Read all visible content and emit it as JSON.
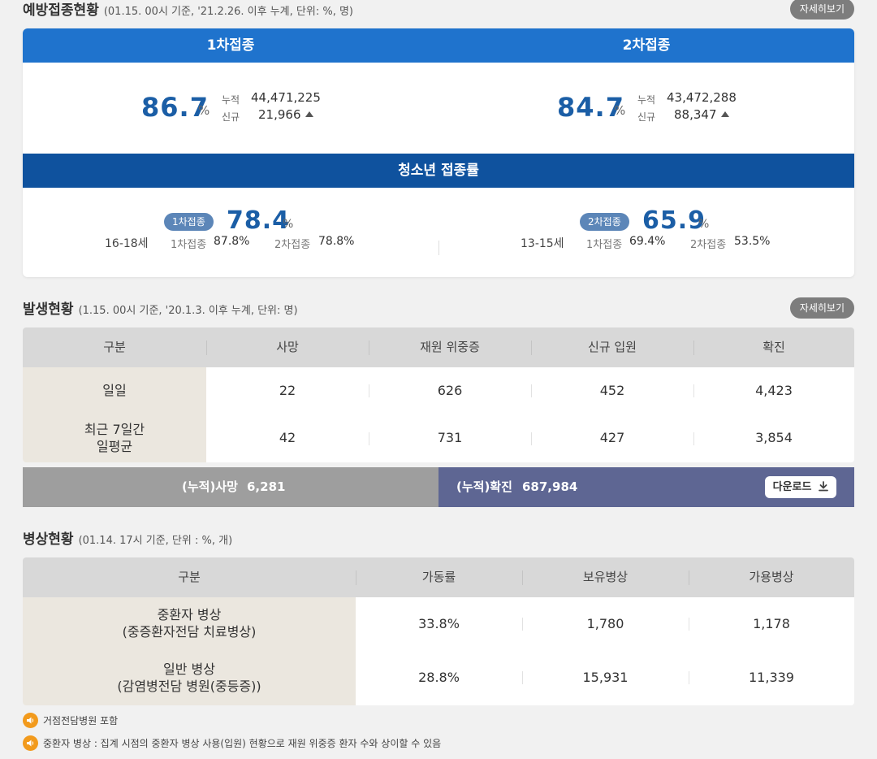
{
  "vaccination": {
    "title": "예방접종현황",
    "subtitle": "(01.15. 00시 기준, '21.2.26. 이후 누계, 단위: %, 명)",
    "detail_label": "자세히보기",
    "first": {
      "head": "1차접종",
      "pct": "86.7",
      "unit": "%",
      "cum_label": "누적",
      "cum_value": "44,471,225",
      "new_label": "신규",
      "new_value": "21,966"
    },
    "second": {
      "head": "2차접종",
      "pct": "84.7",
      "unit": "%",
      "cum_label": "누적",
      "cum_value": "43,472,288",
      "new_label": "신규",
      "new_value": "88,347"
    },
    "youth": {
      "head": "청소년 접종률",
      "left": {
        "age": "16-18세",
        "badge": "1차접종",
        "pct": "78.4",
        "unit": "%",
        "s1_label": "1차접종",
        "s1_value": "87.8%",
        "s2_label": "2차접종",
        "s2_value": "78.8%"
      },
      "right": {
        "age": "13-15세",
        "badge": "2차접종",
        "pct": "65.9",
        "unit": "%",
        "s1_label": "1차접종",
        "s1_value": "69.4%",
        "s2_label": "2차접종",
        "s2_value": "53.5%"
      }
    }
  },
  "outbreak": {
    "title": "발생현황",
    "subtitle": "(1.15. 00시 기준, '20.1.3. 이후 누계, 단위: 명)",
    "detail_label": "자세히보기",
    "headers": [
      "구분",
      "사망",
      "재원 위중증",
      "신규 입원",
      "확진"
    ],
    "rows": [
      {
        "label": "일일",
        "values": [
          "22",
          "626",
          "452",
          "4,423"
        ]
      },
      {
        "label": "최근 7일간\n일평균",
        "values": [
          "42",
          "731",
          "427",
          "3,854"
        ]
      }
    ],
    "cum_death_label": "(누적)사망",
    "cum_death_value": "6,281",
    "cum_confirmed_label": "(누적)확진",
    "cum_confirmed_value": "687,984",
    "download_label": "다운로드"
  },
  "beds": {
    "title": "병상현황",
    "subtitle": "(01.14. 17시 기준, 단위 : %, 개)",
    "headers": [
      "구분",
      "가동률",
      "보유병상",
      "가용병상"
    ],
    "rows": [
      {
        "label": "중환자 병상\n(중증환자전담 치료병상)",
        "values": [
          "33.8%",
          "1,780",
          "1,178"
        ]
      },
      {
        "label": "일반 병상\n(감염병전담 병원(중등증))",
        "values": [
          "28.8%",
          "15,931",
          "11,339"
        ]
      }
    ]
  },
  "notes": [
    "거점전담병원 포함",
    "중환자 병상 : 집계 시점의 중환자 병상 사용(입원) 현황으로 재원 위중증 환자 수와 상이할 수 있음"
  ],
  "colors": {
    "vaccine_head": "#1f73cd",
    "youth_head": "#0f529e",
    "highlight_number": "#1b5ea6",
    "cum_death_bg": "#9e9e9e",
    "cum_confirmed_bg": "#5e6693",
    "note_icon": "#f29a1c"
  },
  "icons": [
    "up-triangle-icon",
    "download-icon",
    "speaker-icon"
  ]
}
